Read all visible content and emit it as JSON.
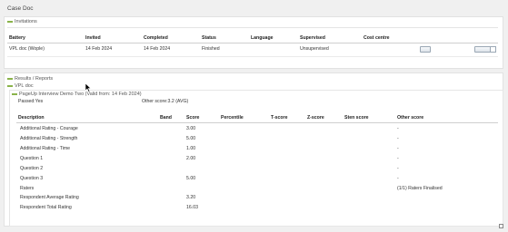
{
  "page_title": "Case Doc",
  "invitations": {
    "heading": "Invitations",
    "columns": [
      "Battery",
      "Invited",
      "Completed",
      "Status",
      "Language",
      "Supervised",
      "Cost centre"
    ],
    "row": {
      "battery": "VPL doc (Wople)",
      "invited": "14 Feb 2024",
      "completed": "14 Feb 2024",
      "status": "Finished",
      "language": "",
      "supervised": "Unsupervised",
      "cost_centre": ""
    }
  },
  "results": {
    "heading": "Results / Reports",
    "subheading": "VPL doc",
    "interview_title": "PageUp Interview Demo Two (Valid from: 14 Feb 2024)",
    "passed_label": "Passed:Yes",
    "other_score_label": "Other score:3.2 (AVG)",
    "columns": [
      "Description",
      "Band",
      "Score",
      "Percentile",
      "T-score",
      "Z-score",
      "Sten score",
      "Other score"
    ],
    "rows": [
      {
        "description": "Additional Rating - Courage",
        "band": "",
        "score": "3.00",
        "other": "-"
      },
      {
        "description": "Additional Rating - Strength",
        "band": "",
        "score": "5.00",
        "other": "-"
      },
      {
        "description": "Additional Rating - Time",
        "band": "",
        "score": "1.00",
        "other": "-"
      },
      {
        "description": "Question 1",
        "band": "",
        "score": "2.00",
        "other": "-"
      },
      {
        "description": "Question 2",
        "band": "",
        "score": "",
        "other": "-"
      },
      {
        "description": "Question 3",
        "band": "",
        "score": "5.00",
        "other": "-"
      },
      {
        "description": "Raters",
        "band": "",
        "score": "",
        "other": "(1/1) Raters Finalised"
      },
      {
        "description": "Respondent Average Rating",
        "band": "",
        "score": "3.20",
        "other": ""
      },
      {
        "description": "Respondent Total Rating",
        "band": "",
        "score": "16.03",
        "other": ""
      }
    ]
  }
}
